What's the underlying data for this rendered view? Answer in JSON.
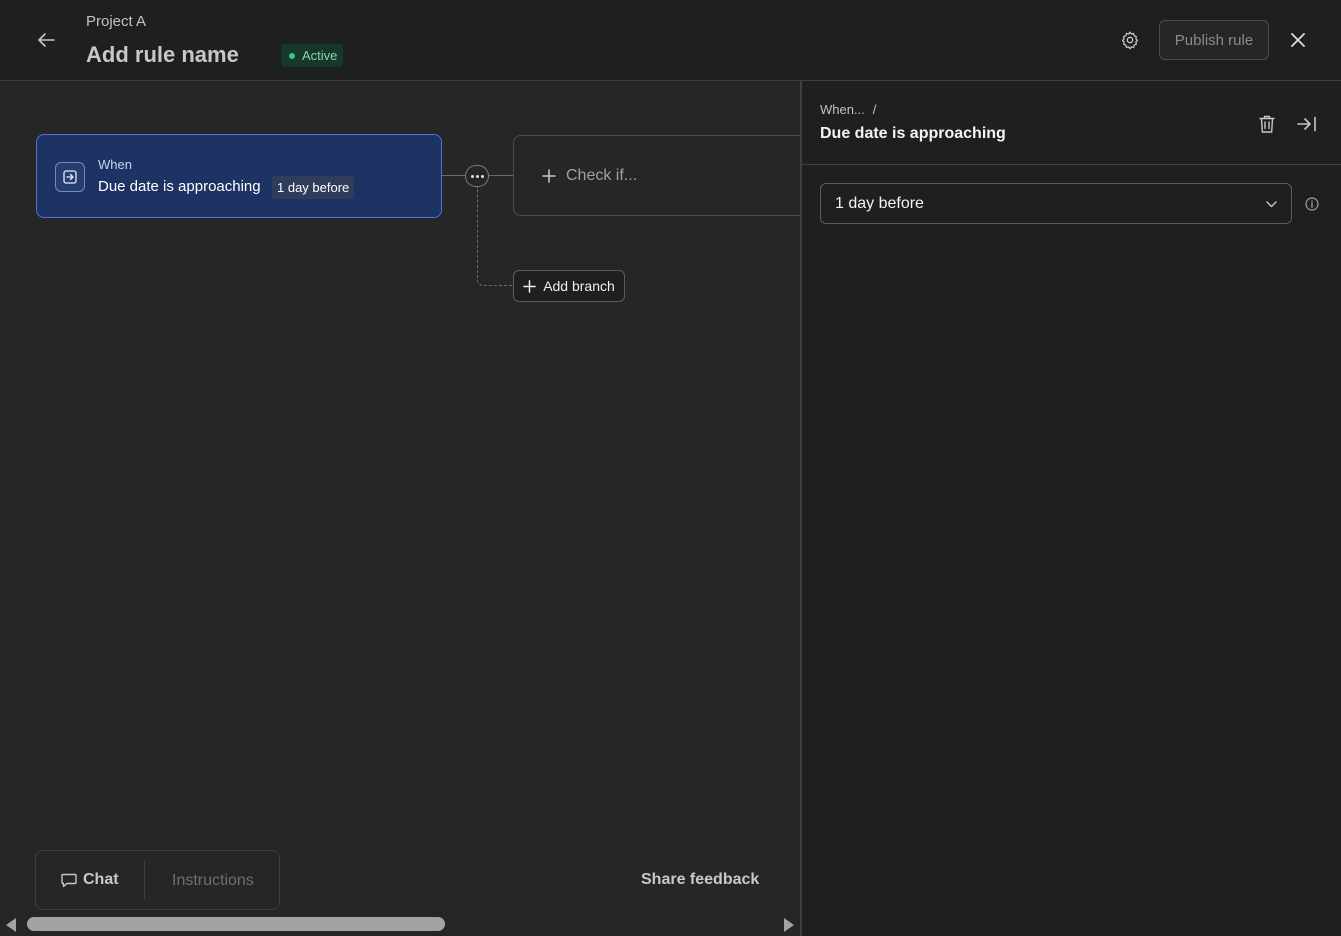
{
  "header": {
    "project_name": "Project A",
    "rule_name": "Add rule name",
    "status": "Active",
    "publish_label": "Publish rule"
  },
  "canvas": {
    "trigger": {
      "when_label": "When",
      "title": "Due date is approaching",
      "chip": "1 day before"
    },
    "check_label": "Check if...",
    "add_branch_label": "Add branch",
    "tabs": {
      "chat": "Chat",
      "instructions": "Instructions"
    },
    "share_feedback": "Share feedback"
  },
  "panel": {
    "breadcrumb_parent": "When...",
    "breadcrumb_sep": "/",
    "title": "Due date is approaching",
    "select_value": "1 day before"
  },
  "colors": {
    "trigger_bg": "#1c3363",
    "trigger_border": "#4c74c9",
    "active_badge_bg": "#16382b",
    "active_dot": "#3cc58b"
  }
}
